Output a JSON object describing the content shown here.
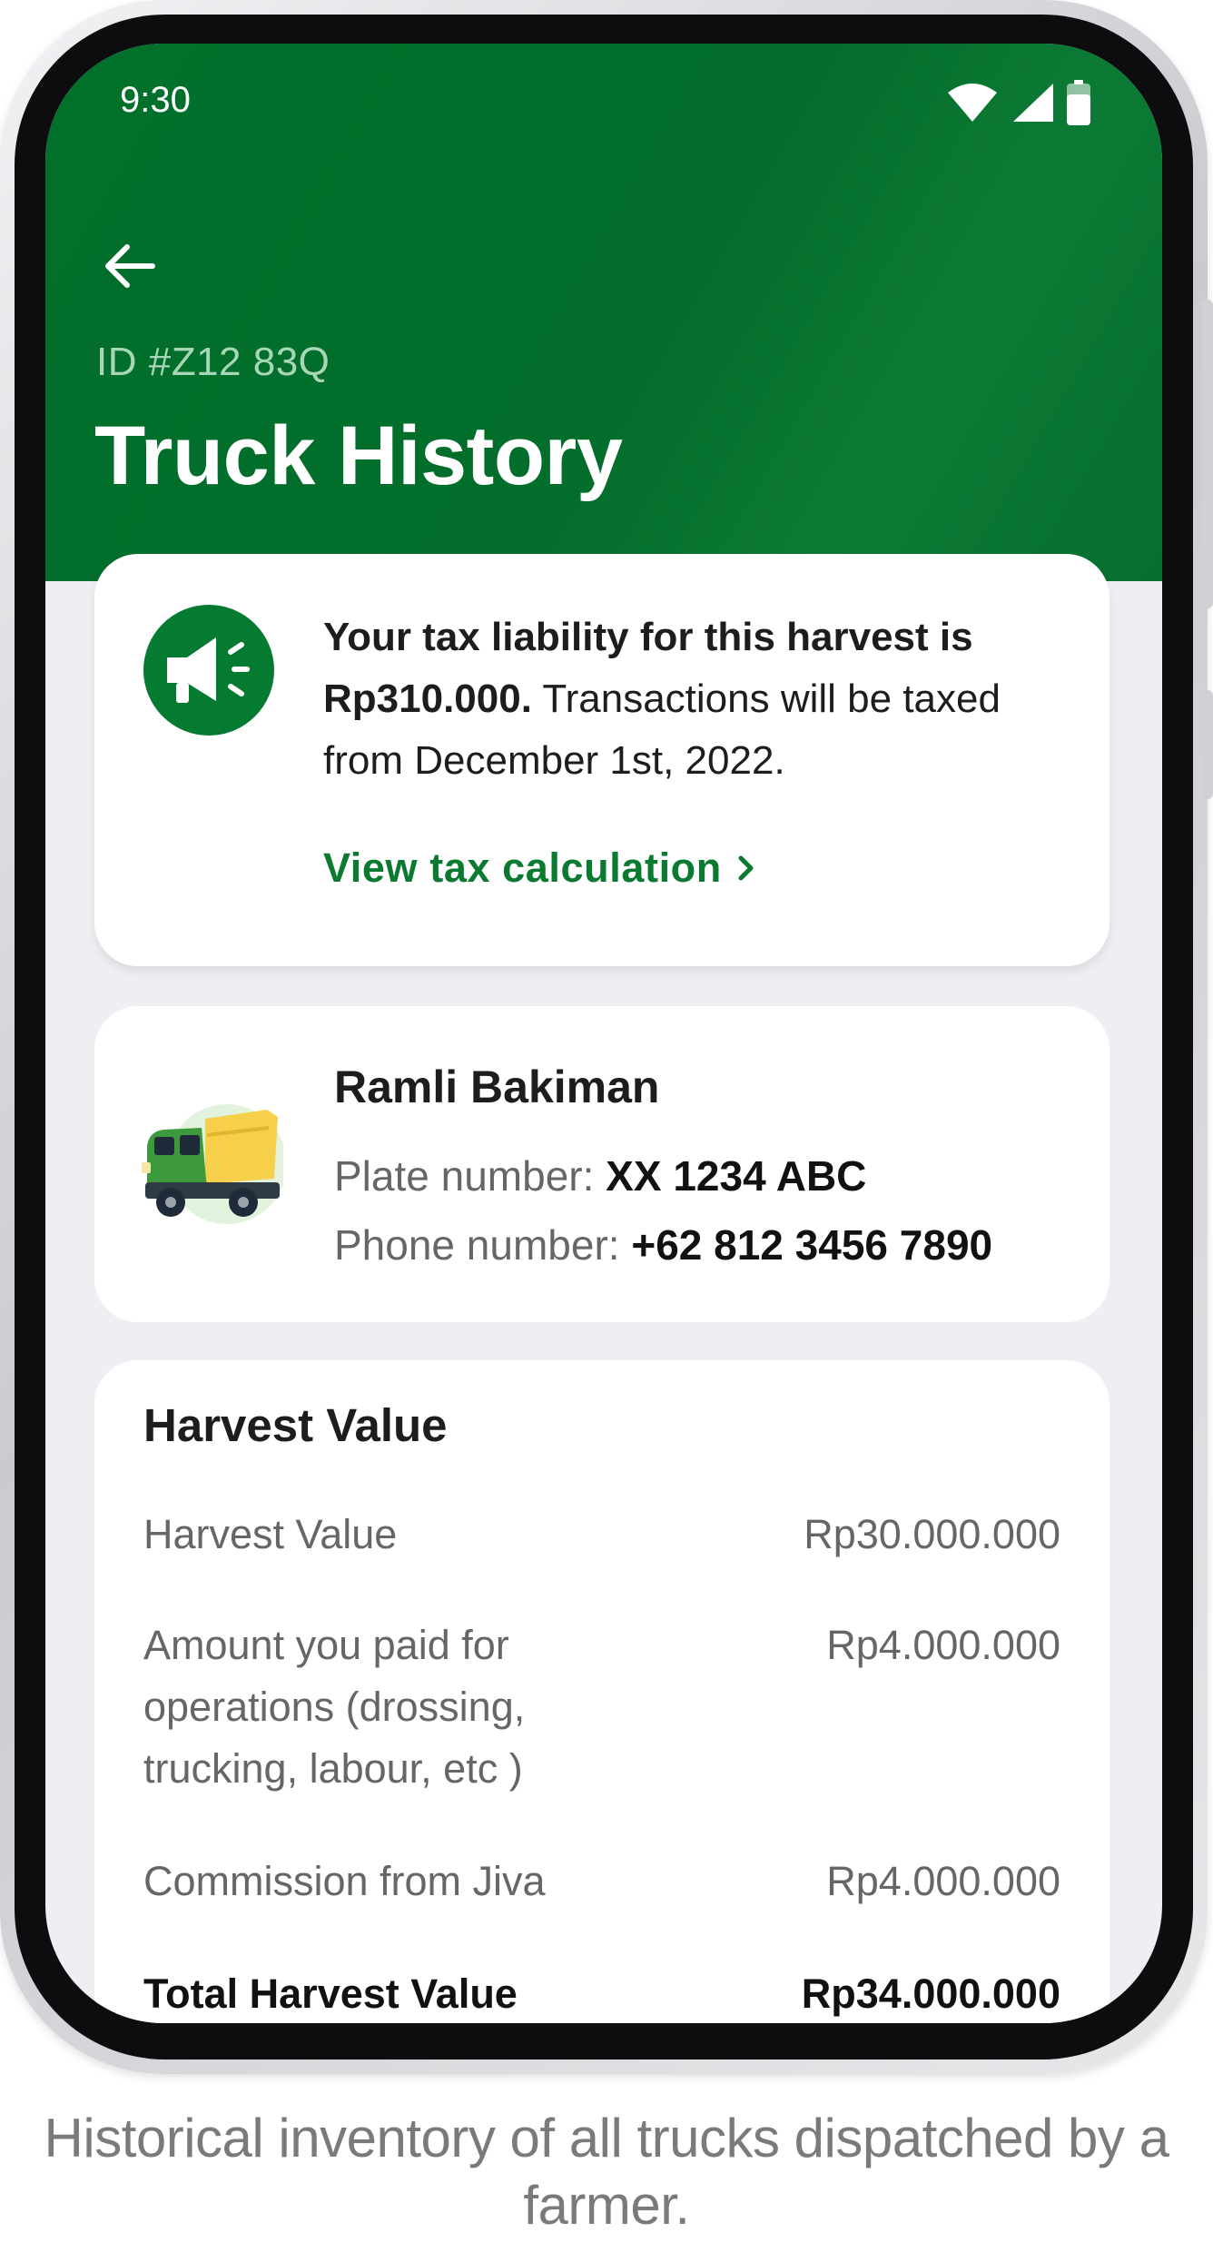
{
  "status_bar": {
    "time": "9:30",
    "icons": [
      "wifi-icon",
      "cellular-signal-icon",
      "battery-icon"
    ]
  },
  "header": {
    "back_icon": "arrow-left-icon",
    "id_label": "ID #Z12 83Q",
    "title": "Truck History",
    "background_color": "#036d2b"
  },
  "tax_notice": {
    "icon": "megaphone-icon",
    "text_bold": "Your tax liability for this harvest is Rp310.000.",
    "text_regular": " Transactions will be taxed from December 1st, 2022.",
    "link_label": "View tax calculation",
    "link_icon": "chevron-right-icon",
    "link_color": "#0a7a31"
  },
  "driver": {
    "avatar_icon": "dump-truck-icon",
    "name": "Ramli Bakiman",
    "plate_label": "Plate number: ",
    "plate_value": "XX 1234 ABC",
    "phone_label": "Phone number: ",
    "phone_value": "+62 812 3456 7890"
  },
  "harvest": {
    "title": "Harvest Value",
    "rows": [
      {
        "label": "Harvest Value",
        "amount": "Rp30.000.000"
      },
      {
        "label": "Amount you paid for operations (drossing, trucking, labour, etc )",
        "amount": "Rp4.000.000"
      },
      {
        "label": "Commission from Jiva",
        "amount": "Rp4.000.000"
      },
      {
        "label": "Total Harvest Value",
        "amount": "Rp34.000.000"
      }
    ]
  },
  "caption": "Historical inventory of all trucks dispatched by a farmer."
}
